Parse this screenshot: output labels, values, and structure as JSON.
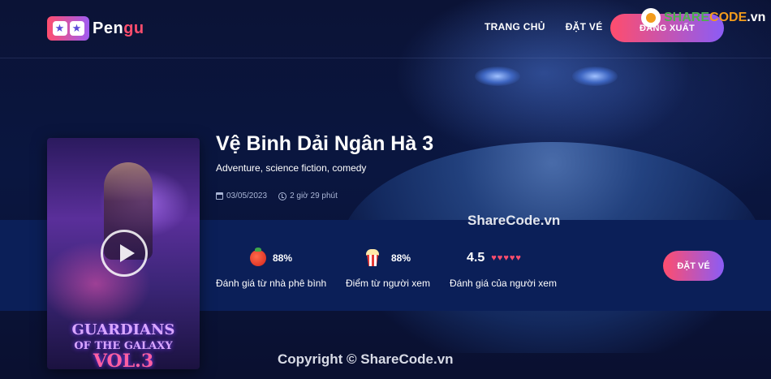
{
  "header": {
    "logo_text_main": "Pen",
    "logo_text_accent": "gu",
    "nav": [
      {
        "label": "TRANG CHỦ"
      },
      {
        "label": "ĐẶT VÉ"
      }
    ],
    "logout_label": "ĐĂNG XUẤT"
  },
  "watermark": {
    "logo_text_1": "SHARE",
    "logo_text_2": "CODE",
    "logo_text_3": ".vn",
    "mid_text": "ShareCode.vn",
    "copyright": "Copyright © ShareCode.vn"
  },
  "movie": {
    "title": "Vệ Binh Dải Ngân Hà 3",
    "genres": "Adventure, science fiction, comedy",
    "release_date": "03/05/2023",
    "duration": "2 giờ 29 phút",
    "poster_title_line1": "GUARDIANS",
    "poster_title_line2": "OF THE GALAXY",
    "poster_vol": "VOL.3"
  },
  "ratings": [
    {
      "icon": "tomato-icon",
      "value": "88%",
      "label": "Đánh giá từ nhà phê bình"
    },
    {
      "icon": "popcorn-icon",
      "value": "88%",
      "label": "Điểm từ người xem"
    },
    {
      "icon": "star-icon",
      "value": "4.5",
      "stars": "♥♥♥♥♥",
      "stars_count": 5,
      "label": "Đánh giá của người xem"
    }
  ],
  "book_label": "ĐẶT VÉ",
  "colors": {
    "accent_start": "#ff4d6d",
    "accent_end": "#8b5cf6",
    "background": "#0a1030",
    "band": "#0b1f58"
  }
}
